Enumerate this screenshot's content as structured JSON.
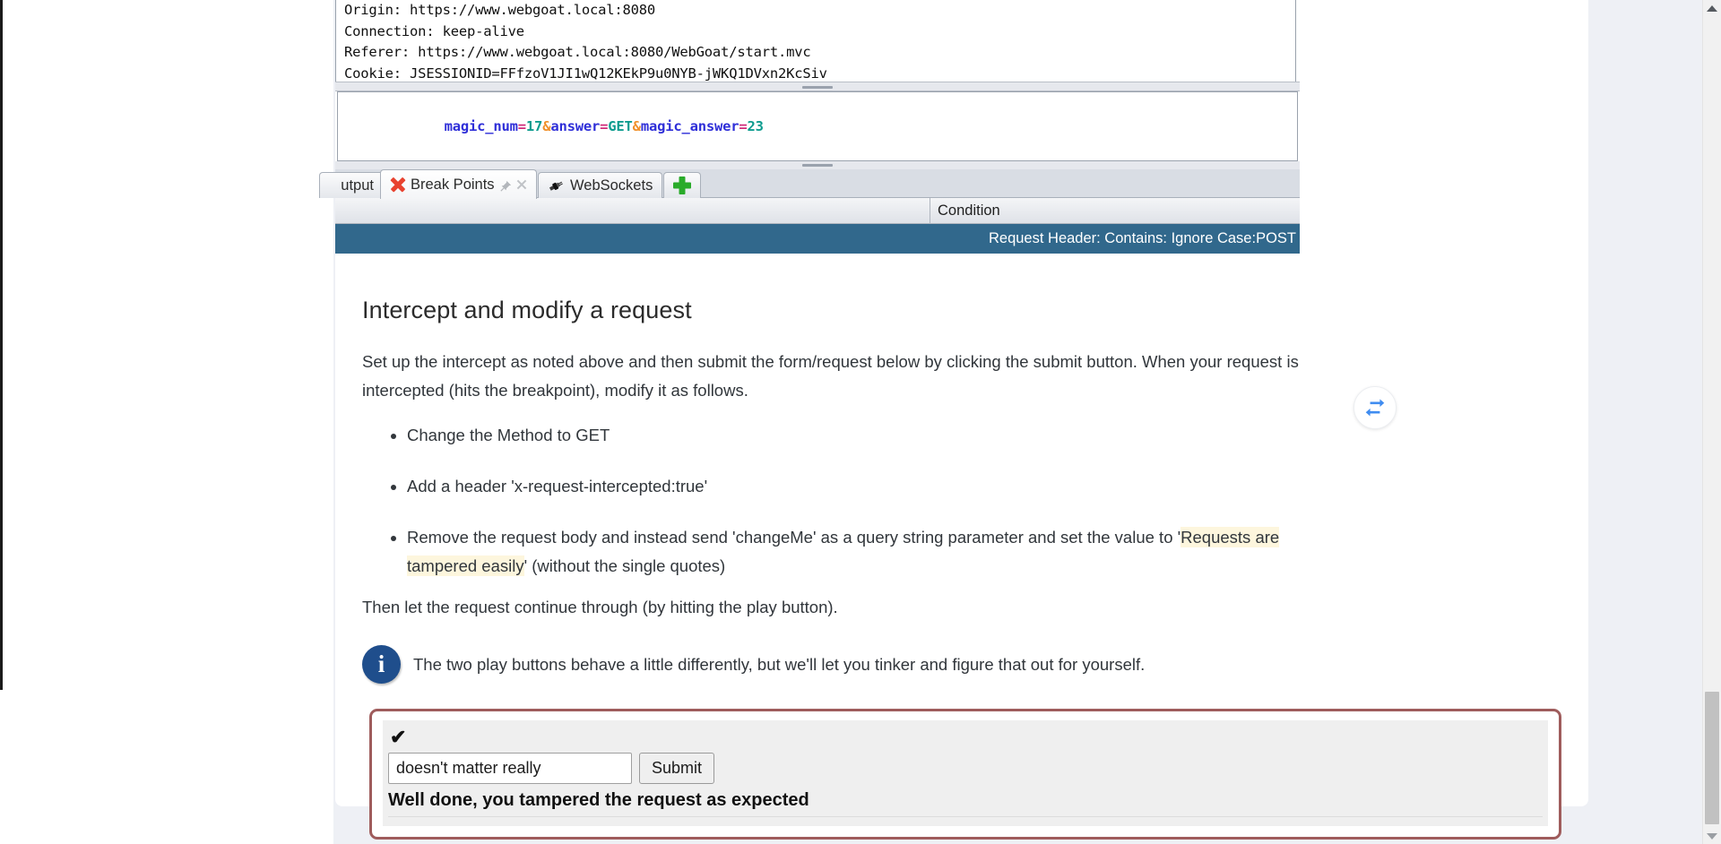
{
  "proxy_panel": {
    "request_headers": [
      "Origin: https://www.webgoat.local:8080",
      "Connection: keep-alive",
      "Referer: https://www.webgoat.local:8080/WebGoat/start.mvc",
      "Cookie: JSESSIONID=FFfzoV1JI1wQ12KEkP9u0NYB-jWKQ1DVxn2KcSiv"
    ],
    "request_body": {
      "tokens": [
        {
          "text": "magic_num",
          "type": "key"
        },
        {
          "text": "=",
          "type": "eq"
        },
        {
          "text": "17",
          "type": "val"
        },
        {
          "text": "&",
          "type": "amp"
        },
        {
          "text": "answer",
          "type": "key"
        },
        {
          "text": "=",
          "type": "eq"
        },
        {
          "text": "GET",
          "type": "val"
        },
        {
          "text": "&",
          "type": "amp"
        },
        {
          "text": "magic_answer",
          "type": "key"
        },
        {
          "text": "=",
          "type": "eq"
        },
        {
          "text": "23",
          "type": "val"
        }
      ],
      "raw": "magic_num=17&answer=GET&magic_answer=23"
    },
    "tabs": [
      {
        "label": "utput",
        "icon": "none",
        "active": false
      },
      {
        "label": "Break Points",
        "icon": "red-x-icon",
        "active": true
      },
      {
        "label": "WebSockets",
        "icon": "plug-icon",
        "active": false
      }
    ],
    "add_tab_label": "+",
    "breakpoints_table": {
      "columns": [
        "",
        "Condition"
      ],
      "rows": [
        {
          "col1": "",
          "condition": "Request Header: Contains: Ignore Case:POST",
          "selected": true
        }
      ],
      "selected_row_color": "#31688c"
    }
  },
  "lesson": {
    "title": "Intercept and modify a request",
    "intro": "Set up the intercept as noted above and then submit the form/request below by clicking the submit button. When your request is intercepted (hits the breakpoint), modify it as follows.",
    "steps": [
      {
        "prefix": "Change the Method to GET",
        "highlight": "",
        "suffix": ""
      },
      {
        "prefix": "Add a header 'x-request-intercepted:true'",
        "highlight": "",
        "suffix": ""
      },
      {
        "prefix": "Remove the request body and instead send 'changeMe' as a query string parameter and set the value to '",
        "highlight": "Requests are tampered easily",
        "suffix": "' (without the single quotes)"
      }
    ],
    "outro": "Then let the request continue through (by hitting the play button).",
    "note": "The two play buttons behave a little differently, but we'll let you tinker and figure that out for yourself.",
    "note_icon": "i",
    "highlight_color": "#fdf6dd",
    "sync_icon_color": "#3f8cf0"
  },
  "assignment": {
    "status_check": "✔",
    "input_value": "doesn't matter really",
    "input_placeholder": "",
    "submit_label": "Submit",
    "result_message": "Well done, you tampered the request as expected",
    "border_color": "#9f5c5c"
  },
  "scrollbar": {
    "up_arrow": "▲",
    "down_arrow": "▼"
  }
}
